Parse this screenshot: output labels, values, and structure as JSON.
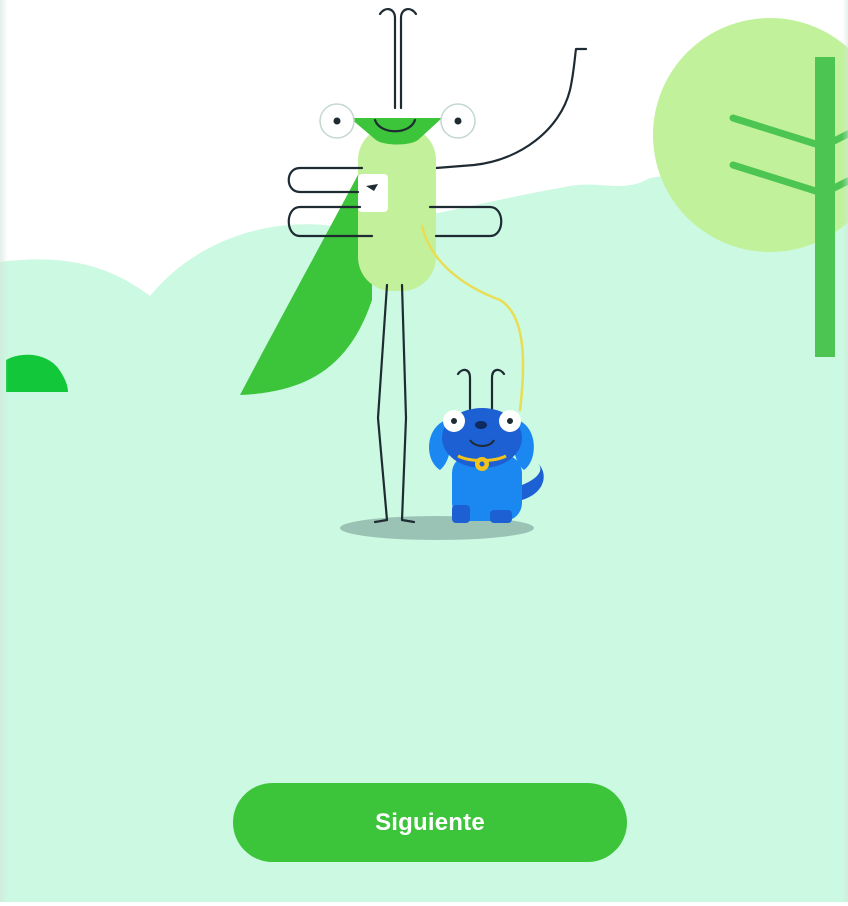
{
  "illustration": {
    "description_icons": [
      "grasshopper-character",
      "dog-character",
      "tree-icon",
      "bush-icon",
      "leash"
    ],
    "colors": {
      "sky": "#ffffff",
      "ground": "#ccf9e1",
      "grasshopper_wing": "#3cc43a",
      "grasshopper_body": "#c3f09b",
      "grasshopper_head": "#3cc43a",
      "tree_canopy": "#c1f29b",
      "tree_trunk": "#4cc552",
      "bush": "#12c83a",
      "dog_body": "#1b88f2",
      "dog_head": "#1c60d3",
      "leash": "#e9dd55",
      "collar": "#f2c31d",
      "shadow": "#9ac3b5",
      "line": "#1e2b33"
    }
  },
  "footer": {
    "next_label": "Siguiente"
  },
  "theme": {
    "accent": "#3cc43a",
    "button_text": "#ffffff"
  }
}
